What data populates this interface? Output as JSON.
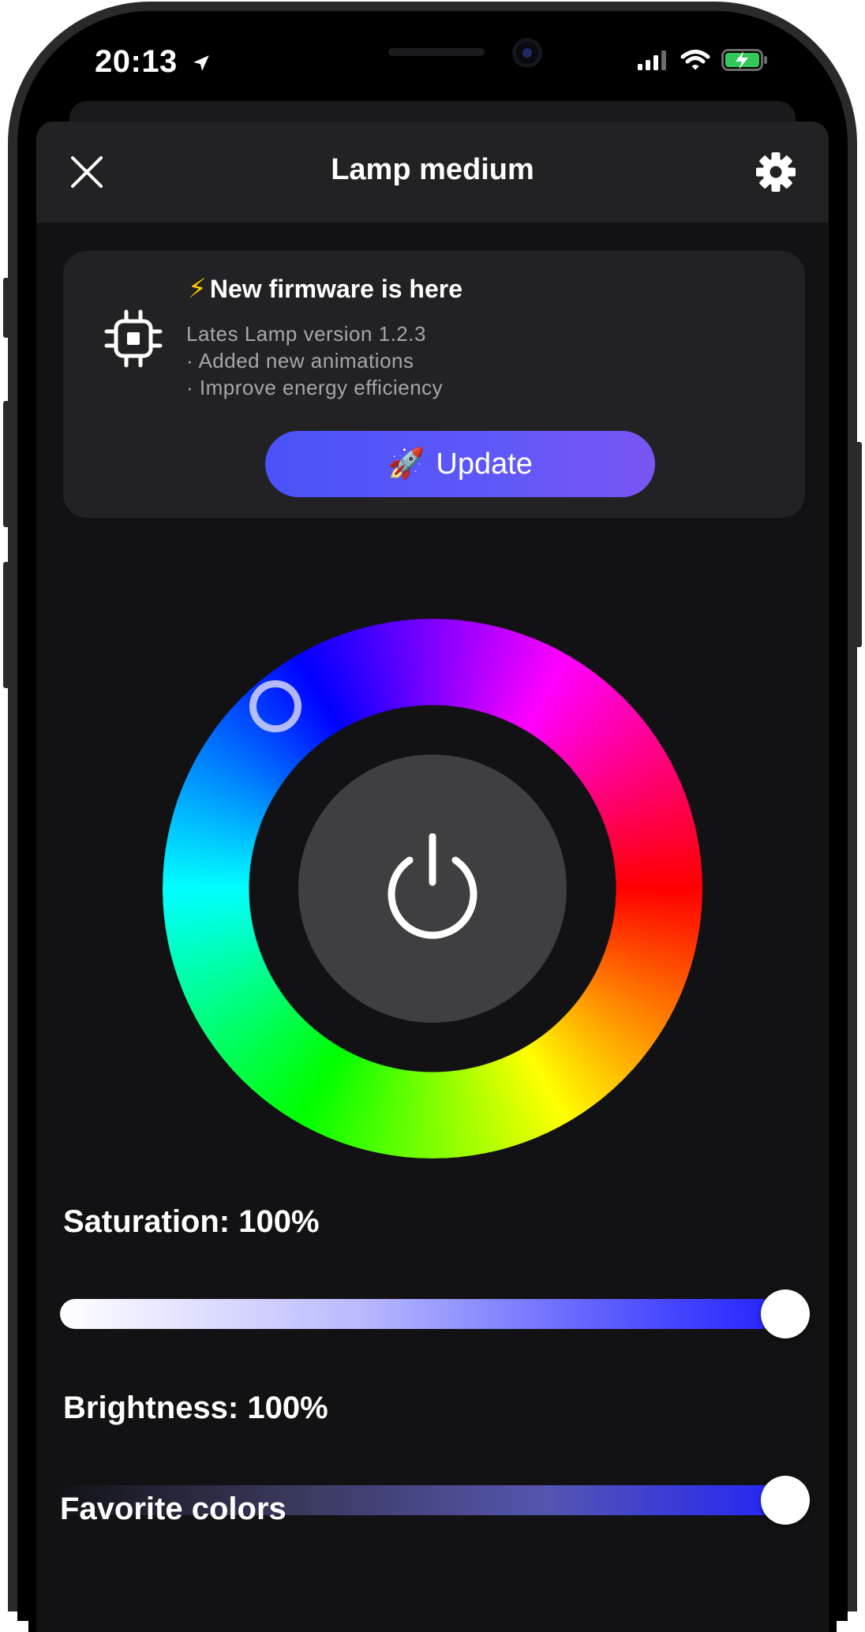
{
  "status_bar": {
    "time": "20:13",
    "location_icon": "location-arrow-icon",
    "signal_icon": "cellular-signal-icon",
    "wifi_icon": "wifi-icon",
    "battery_icon": "battery-charging-icon",
    "battery_color": "#34c759"
  },
  "header": {
    "title": "Lamp medium",
    "close_icon": "close-icon",
    "settings_icon": "gear-icon"
  },
  "firmware": {
    "bolt": "⚡",
    "title": "New firmware is here",
    "line1": "Lates Lamp version 1.2.3",
    "line2": "· Added new animations",
    "line3": "· Improve energy efficiency",
    "chip_icon": "chip-icon",
    "update_emoji": "🚀",
    "update_label": "Update",
    "accent": "#5b57f7"
  },
  "color_wheel": {
    "selected_hue_deg": 235,
    "power_icon": "power-icon"
  },
  "saturation": {
    "label": "Saturation: 100%",
    "value_percent": 100
  },
  "brightness": {
    "label": "Brightness: 100%",
    "value_percent": 100
  },
  "favorites": {
    "label": "Favorite colors"
  }
}
